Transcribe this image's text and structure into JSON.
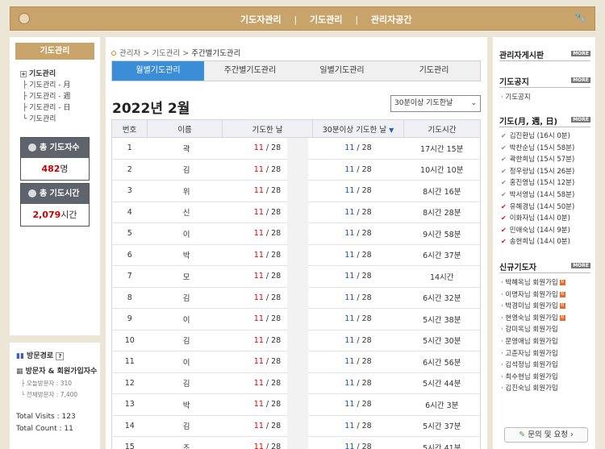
{
  "topnav": {
    "items": [
      "기도자관리",
      "기도관리",
      "관리자공간"
    ]
  },
  "left": {
    "title": "기도관리",
    "tree_root": "기도관리",
    "tree_children": [
      "기도관리 - 月",
      "기도관리 - 週",
      "기도관리 - 日",
      "기도관리"
    ],
    "stat1": {
      "label": "총 기도자수",
      "value": "482",
      "unit": "명"
    },
    "stat2": {
      "label": "총 기도시간",
      "value": "2,079",
      "unit": "시간"
    }
  },
  "visitor": {
    "title": "방문경로",
    "help": "?",
    "sub_title": "방문자 & 회원가입자수",
    "today": "오늘방문자 : 310",
    "total": "전체방문자 : 7,400",
    "total_visits": "Total Visits : 123",
    "total_count": "Total Count : 11"
  },
  "breadcrumb": [
    "관리자",
    "기도관리",
    "주간별기도관리"
  ],
  "tabs": [
    "월별기도관리",
    "주간별기도관리",
    "일별기도관리",
    "기도관리"
  ],
  "month_title": "2022년  2월",
  "select_value": "30분이상 기도한날",
  "table": {
    "headers": [
      "번호",
      "이름",
      "기도한 날",
      "30분이상 기도한 날",
      "기도시간"
    ],
    "sort_icon": "▼",
    "rows": [
      {
        "no": "1",
        "name": "곽",
        "d1": "11",
        "d1b": " / 28",
        "d2": "11",
        "d2b": " / 28",
        "time": "17시간 15분"
      },
      {
        "no": "2",
        "name": "김",
        "d1": "11",
        "d1b": " / 28",
        "d2": "11",
        "d2b": " / 28",
        "time": "10시간 10분"
      },
      {
        "no": "3",
        "name": "위",
        "d1": "11",
        "d1b": " / 28",
        "d2": "11",
        "d2b": " / 28",
        "time": "8시간 16분"
      },
      {
        "no": "4",
        "name": "신",
        "d1": "11",
        "d1b": " / 28",
        "d2": "11",
        "d2b": " / 28",
        "time": "8시간 28분"
      },
      {
        "no": "5",
        "name": "이",
        "d1": "11",
        "d1b": " / 28",
        "d2": "11",
        "d2b": " / 28",
        "time": "9시간 58분"
      },
      {
        "no": "6",
        "name": "박",
        "d1": "11",
        "d1b": " / 28",
        "d2": "11",
        "d2b": " / 28",
        "time": "6시간 37분"
      },
      {
        "no": "7",
        "name": "모",
        "d1": "11",
        "d1b": " / 28",
        "d2": "11",
        "d2b": " / 28",
        "time": "14시간"
      },
      {
        "no": "8",
        "name": "김",
        "d1": "11",
        "d1b": " / 28",
        "d2": "11",
        "d2b": " / 28",
        "time": "6시간 32분"
      },
      {
        "no": "9",
        "name": "이",
        "d1": "11",
        "d1b": " / 28",
        "d2": "11",
        "d2b": " / 28",
        "time": "5시간 38분"
      },
      {
        "no": "10",
        "name": "김",
        "d1": "11",
        "d1b": " / 28",
        "d2": "11",
        "d2b": " / 28",
        "time": "5시간 30분"
      },
      {
        "no": "11",
        "name": "이",
        "d1": "11",
        "d1b": " / 28",
        "d2": "11",
        "d2b": " / 28",
        "time": "6시간 56분"
      },
      {
        "no": "12",
        "name": "김",
        "d1": "11",
        "d1b": " / 28",
        "d2": "11",
        "d2b": " / 28",
        "time": "5시간 44분"
      },
      {
        "no": "13",
        "name": "박",
        "d1": "11",
        "d1b": " / 28",
        "d2": "11",
        "d2b": " / 28",
        "time": "6시간 3분"
      },
      {
        "no": "14",
        "name": "김",
        "d1": "11",
        "d1b": " / 28",
        "d2": "11",
        "d2b": " / 28",
        "time": "5시간 37분"
      },
      {
        "no": "15",
        "name": "조",
        "d1": "11",
        "d1b": " / 28",
        "d2": "11",
        "d2b": " / 28",
        "time": "5시간 41분"
      }
    ]
  },
  "right": {
    "board_title": "관리자게시판",
    "notice_title": "기도공지",
    "notice_items": [
      "기도공지"
    ],
    "prayer_title": "기도(月, 週, 日)",
    "prayer_items": [
      {
        "text": "김진환님 (16시 0분)",
        "red": false
      },
      {
        "text": "박찬순님 (15시 58분)",
        "red": false
      },
      {
        "text": "곽한희님 (15시 57분)",
        "red": false
      },
      {
        "text": "정우랑님 (15시 26분)",
        "red": false
      },
      {
        "text": "홍진영님 (15시 12분)",
        "red": false
      },
      {
        "text": "박서영님 (14시 58분)",
        "red": false
      },
      {
        "text": "유혜경님 (14시 50분)",
        "red": true
      },
      {
        "text": "이화자님 (14시 0분)",
        "red": true
      },
      {
        "text": "민애숙님 (14시 9분)",
        "red": true
      },
      {
        "text": "송현희님 (14시 0분)",
        "red": true
      }
    ],
    "new_title": "신규기도자",
    "new_items": [
      {
        "text": "박혜옥님 회원가입",
        "new": true
      },
      {
        "text": "이명자님 회원가입",
        "new": true
      },
      {
        "text": "박경미님 회원가입",
        "new": true
      },
      {
        "text": "현영숙님 회원가입",
        "new": true
      },
      {
        "text": "강미옥님 회원가입",
        "new": false
      },
      {
        "text": "문영애님 회원가입",
        "new": false
      },
      {
        "text": "고춘자님 회원가입",
        "new": false
      },
      {
        "text": "김석정님 회원가입",
        "new": false
      },
      {
        "text": "최수현님 회원가입",
        "new": false
      },
      {
        "text": "김진숙님 회원가입",
        "new": false
      }
    ],
    "more_label": "MORE",
    "new_badge": "N",
    "contact": "문의 및 요청"
  }
}
